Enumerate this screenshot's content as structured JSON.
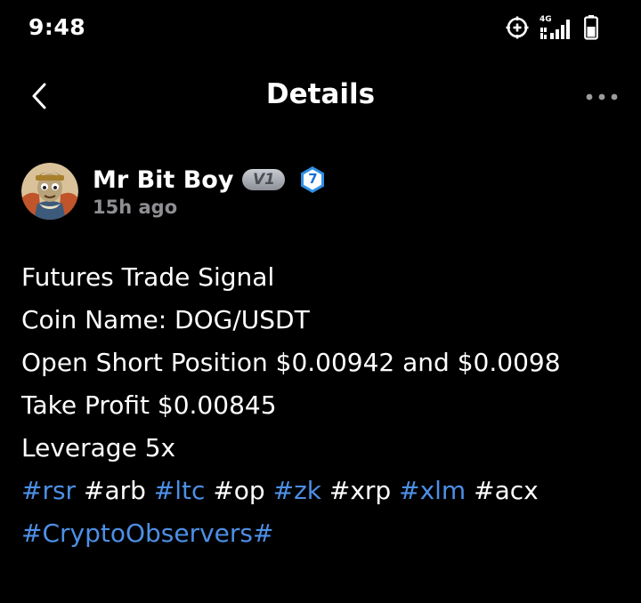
{
  "status_bar": {
    "time": "9:48",
    "network_label": "4G"
  },
  "header": {
    "title": "Details"
  },
  "author": {
    "name": "Mr Bit Boy",
    "vip_badge": "V1",
    "level": "7",
    "posted_time": "15h ago"
  },
  "post": {
    "lines": [
      "Futures Trade Signal",
      "Coin Name: DOG/USDT",
      "Open Short Position $0.00942 and $0.0098",
      "Take Profit $0.00845",
      "Leverage 5x"
    ],
    "tags": [
      "#rsr",
      "#arb",
      "#ltc",
      "#op",
      "#zk",
      "#xrp",
      "#xlm",
      "#acx",
      "#CryptoObservers#"
    ]
  },
  "colors": {
    "background": "#000000",
    "text": "#ffffff",
    "muted": "#8e8e93",
    "hashtag_link": "#4d8fe6",
    "level_badge": "#2f8fe8"
  }
}
